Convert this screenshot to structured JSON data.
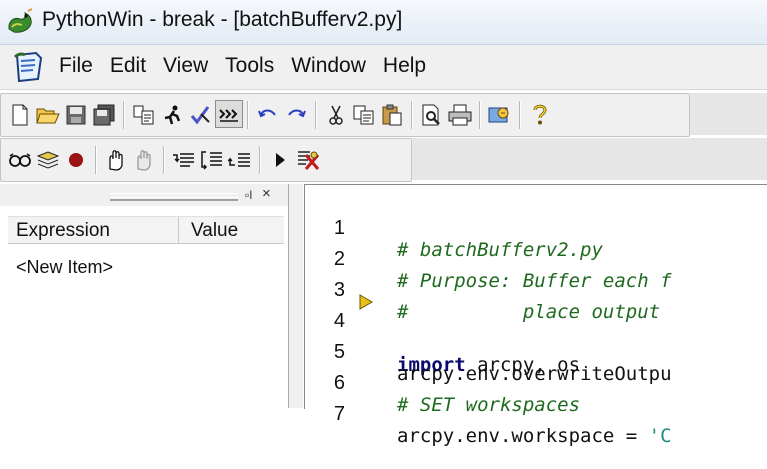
{
  "window": {
    "title": "PythonWin - break - [batchBufferv2.py]"
  },
  "menu": [
    "File",
    "Edit",
    "View",
    "Tools",
    "Window",
    "Help"
  ],
  "toolbar_icons": [
    "new-icon",
    "open-icon",
    "save-icon",
    "save-all-icon",
    "copy-special-icon",
    "run-icon",
    "check-icon",
    "indent-icon",
    "undo-icon",
    "redo-icon",
    "cut-icon",
    "copy-icon",
    "paste-icon",
    "print-preview-icon",
    "print-icon",
    "interactive-window-icon",
    "help-icon"
  ],
  "debug_toolbar_icons": [
    "watch-icon",
    "stack-icon",
    "breakpoint-icon",
    "go-icon",
    "stop-icon",
    "step-in-icon",
    "step-over-icon",
    "step-out-icon",
    "run-to-cursor-icon",
    "close-debugger-icon"
  ],
  "watch_panel": {
    "columns": [
      "Expression",
      "Value"
    ],
    "rows": [
      "<New Item>"
    ]
  },
  "editor": {
    "current_line": 4,
    "lines": [
      {
        "num": "1",
        "text": "# batchBufferv2.py",
        "type": "comment"
      },
      {
        "num": "2",
        "text": "# Purpose: Buffer each f",
        "type": "comment"
      },
      {
        "num": "3",
        "text": "#          place output ",
        "type": "comment"
      },
      {
        "num": "4",
        "kw": "import",
        "text": " arcpy, os",
        "type": "import"
      },
      {
        "num": "5",
        "text": "arcpy.env.overwriteOutpu",
        "type": "plain"
      },
      {
        "num": "6",
        "text": "# SET workspaces",
        "type": "comment"
      },
      {
        "num": "7",
        "text": "arcpy.env.workspace = ",
        "str": "'C",
        "type": "assign"
      }
    ]
  },
  "colors": {
    "comment": "#1f6a1f",
    "keyword": "#0b0b6e",
    "string": "#1c8c7e",
    "marker": "#e8c21a"
  }
}
